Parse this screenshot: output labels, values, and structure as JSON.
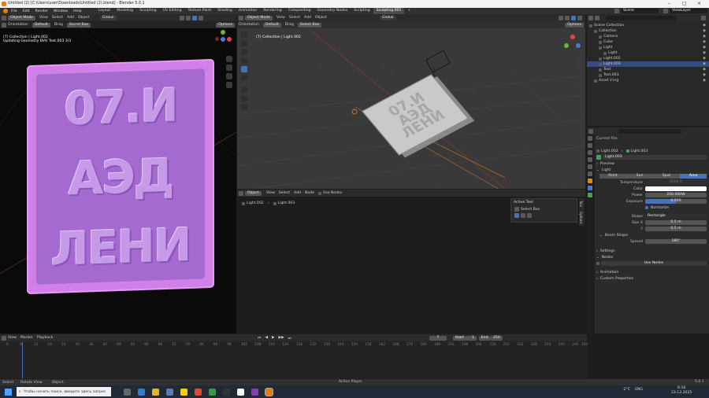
{
  "titlebar": {
    "title": "Untitled (2) [C:\\Users\\user\\Downloads\\Untitled (2).blend] - Blender 5.0.1"
  },
  "menubar": {
    "menus": [
      "File",
      "Edit",
      "Render",
      "Window",
      "Help"
    ],
    "workspaces": [
      "Layout",
      "Modeling",
      "Sculpting",
      "UV Editing",
      "Texture Paint",
      "Shading",
      "Animation",
      "Rendering",
      "Compositing",
      "Geometry Nodes",
      "Scripting",
      "Sculpting.001"
    ],
    "active_workspace": "Sculpting.001",
    "scene": "Scene",
    "view_layer": "ViewLayer"
  },
  "left_viewport": {
    "mode": "Object Mode",
    "menus": [
      "View",
      "Select",
      "Add",
      "Object"
    ],
    "orientation_label": "Orientation",
    "orientation": "Default",
    "drag_label": "Drag",
    "drag_value": "Select Box",
    "transform": "Global",
    "options": "Options",
    "overlay_line1": "(7) Collection | Light.002",
    "overlay_line2": "Updating Geometry BVH Text.003 3/3",
    "poster_lines": [
      "07.И",
      "АЭД",
      "ЛЕНИ"
    ]
  },
  "right_viewport": {
    "mode": "Object Mode",
    "menus": [
      "View",
      "Select",
      "Add",
      "Object"
    ],
    "orientation_label": "Orientation",
    "orientation": "Default",
    "drag_label": "Drag",
    "drag_value": "Select Box",
    "transform": "Global",
    "options": "Options",
    "overlay_line1": "(7) Collection | Light.002"
  },
  "node_editor": {
    "type": "Object",
    "menus": [
      "View",
      "Select",
      "Add",
      "Node"
    ],
    "use_nodes": "Use Nodes",
    "breadcrumb": [
      "Light.002",
      "Light.003"
    ],
    "active_tool_title": "Active Tool",
    "active_tool_item": "Select Box",
    "side_tabs": [
      "Tool",
      "Options"
    ]
  },
  "outliner": {
    "rows": [
      {
        "label": "Scene Collection",
        "indent": 0
      },
      {
        "label": "Collection",
        "indent": 1
      },
      {
        "label": "Camera",
        "indent": 2
      },
      {
        "label": "Cube",
        "indent": 2
      },
      {
        "label": "Light",
        "indent": 2
      },
      {
        "label": "Light",
        "indent": 3
      },
      {
        "label": "Light.002",
        "indent": 2
      },
      {
        "label": "Light.003",
        "indent": 2,
        "selected": true
      },
      {
        "label": "Text",
        "indent": 2
      },
      {
        "label": "Text.003",
        "indent": 2
      },
      {
        "label": "Asset V.ing",
        "indent": 1
      }
    ]
  },
  "properties": {
    "current_file": "Current File",
    "breadcrumb": [
      "Light.002",
      "Light.003"
    ],
    "datablock": "Light.003",
    "preview": "Preview",
    "light_section": "Light",
    "light_types": [
      "Point",
      "Sun",
      "Spot",
      "Area"
    ],
    "active_type": "Area",
    "temperature_label": "Temperature",
    "temperature": "6500 K",
    "color_label": "Color",
    "color": "#ffffff",
    "power_label": "Power",
    "power": "200.000W",
    "exposure_label": "Exposure",
    "exposure": "0.000",
    "normalize": "Normalize",
    "shape_label": "Shape",
    "shape": "Rectangle",
    "size_x_label": "Size X",
    "size_x": "0.5 m",
    "size_y_label": "Y",
    "size_y": "0.5 m",
    "beam_shape": "Beam Shape",
    "spread_label": "Spread",
    "spread": "180°",
    "sections": [
      "Settings",
      "Nodes"
    ],
    "use_nodes": "Use Nodes",
    "sections2": [
      "Animation",
      "Custom Properties"
    ]
  },
  "timeline": {
    "menus": [
      "View",
      "Marker",
      "Playback"
    ],
    "current_frame": "7",
    "start_label": "Start",
    "start": "1",
    "end_label": "End",
    "end": "250",
    "ticks": [
      "0",
      "6",
      "12",
      "18",
      "24",
      "30",
      "36",
      "42",
      "48",
      "54",
      "60",
      "66",
      "72",
      "78",
      "84",
      "90",
      "96",
      "102",
      "108",
      "114",
      "120",
      "126",
      "132",
      "138",
      "144",
      "150",
      "156",
      "162",
      "168",
      "174",
      "180",
      "186",
      "192",
      "198",
      "204",
      "210",
      "216",
      "222",
      "228",
      "234",
      "240",
      "246",
      "250"
    ]
  },
  "statusbar": {
    "left": [
      "Select",
      "Rotate View",
      "Object"
    ],
    "center": "Active Player",
    "right": "5.0.1"
  },
  "taskbar": {
    "search_placeholder": "Чтобы начать поиск, введите здесь запрос",
    "time": "6:16",
    "date": "23.12.2025",
    "lang": "ENG",
    "temp": "-2°C"
  },
  "colors": {
    "poster": "#b57be0",
    "frame": "#d47ee8",
    "accent": "#4772b3",
    "bg": "#1d1d1d"
  }
}
